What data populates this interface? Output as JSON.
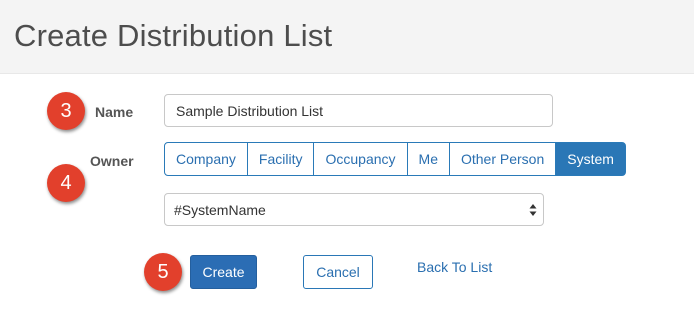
{
  "header": {
    "title": "Create Distribution List"
  },
  "steps": {
    "name_step": "3",
    "owner_step": "4",
    "create_step": "5"
  },
  "form": {
    "name_label": "Name",
    "name_value": "Sample Distribution List",
    "owner_label": "Owner",
    "owner_options": [
      "Company",
      "Facility",
      "Occupancy",
      "Me",
      "Other Person",
      "System"
    ],
    "owner_selected": "System",
    "system_select_value": "#SystemName"
  },
  "actions": {
    "create_label": "Create",
    "cancel_label": "Cancel",
    "back_label": "Back To List"
  },
  "colors": {
    "badge": "#e2402c",
    "primary": "#2a77b6",
    "link": "#2a6fb0",
    "header_bg": "#f4f4f4"
  },
  "icons": {
    "select_arrows": "up-down-caret-icon"
  }
}
